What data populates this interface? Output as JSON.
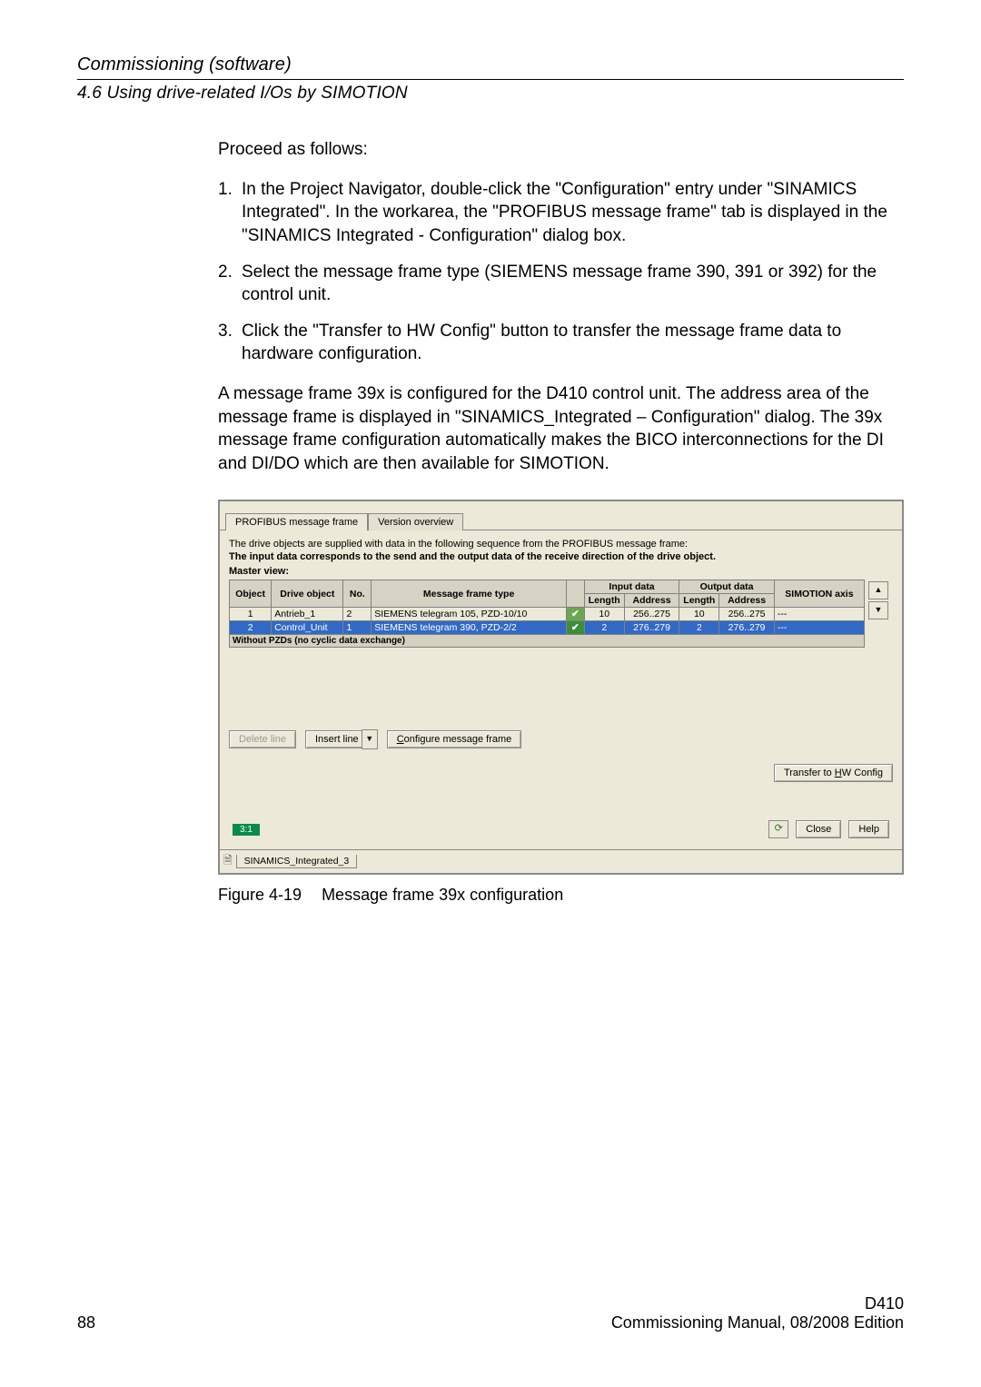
{
  "header": {
    "title": "Commissioning (software)",
    "section": "4.6 Using drive-related I/Os by SIMOTION"
  },
  "body": {
    "intro": "Proceed as follows:",
    "steps": [
      "In the Project Navigator, double-click the \"Configuration\" entry under \"SINAMICS Integrated\". In the workarea, the \"PROFIBUS message frame\" tab is displayed in the \"SINAMICS Integrated - Configuration\" dialog box.",
      "Select the message frame type (SIEMENS message frame 390, 391 or 392) for the control unit.",
      "Click the \"Transfer to HW Config\" button to transfer the message frame data to hardware configuration."
    ],
    "para": "A message frame 39x is configured for the D410 control unit. The address area of the message frame is displayed in \"SINAMICS_Integrated – Configuration\" dialog. The 39x message frame configuration automatically makes the BICO interconnections for the DI and DI/DO which are then available for SIMOTION."
  },
  "dialog": {
    "tabs": {
      "active": "PROFIBUS message frame",
      "inactive": "Version overview"
    },
    "info1": "The drive objects are supplied with data in the following sequence from the PROFIBUS message frame:",
    "info2": "The input data corresponds to the send and the output data of the receive direction of the drive object.",
    "master_view": "Master view:",
    "headers": {
      "object": "Object",
      "drive_object": "Drive object",
      "no": "No.",
      "msg_type": "Message frame type",
      "input_data": "Input data",
      "output_data": "Output data",
      "length": "Length",
      "address": "Address",
      "simotion_axis": "SIMOTION axis"
    },
    "rows": [
      {
        "object": "1",
        "drive_object": "Antrieb_1",
        "no": "2",
        "msg_type": "SIEMENS telegram 105, PZD-10/10",
        "in_len": "10",
        "in_addr": "256..275",
        "out_len": "10",
        "out_addr": "256..275",
        "axis": "---"
      },
      {
        "object": "2",
        "drive_object": "Control_Unit",
        "no": "1",
        "msg_type": "SIEMENS telegram 390, PZD-2/2",
        "in_len": "2",
        "in_addr": "276..279",
        "out_len": "2",
        "out_addr": "276..279",
        "axis": "---"
      }
    ],
    "no_pzd_row": "Without PZDs (no cyclic data exchange)",
    "buttons": {
      "delete_line": "Delete line",
      "insert_line": "Insert line",
      "configure": "Configure message frame",
      "transfer": "Transfer to HW Config",
      "close": "Close",
      "help": "Help"
    },
    "status_chip": "3:1",
    "bottom_tab": "SINAMICS_Integrated_3"
  },
  "figure": {
    "label": "Figure 4-19",
    "caption": "Message frame 39x configuration"
  },
  "footer": {
    "page_num": "88",
    "doc_id": "D410",
    "doc_title": "Commissioning Manual, 08/2008 Edition"
  }
}
